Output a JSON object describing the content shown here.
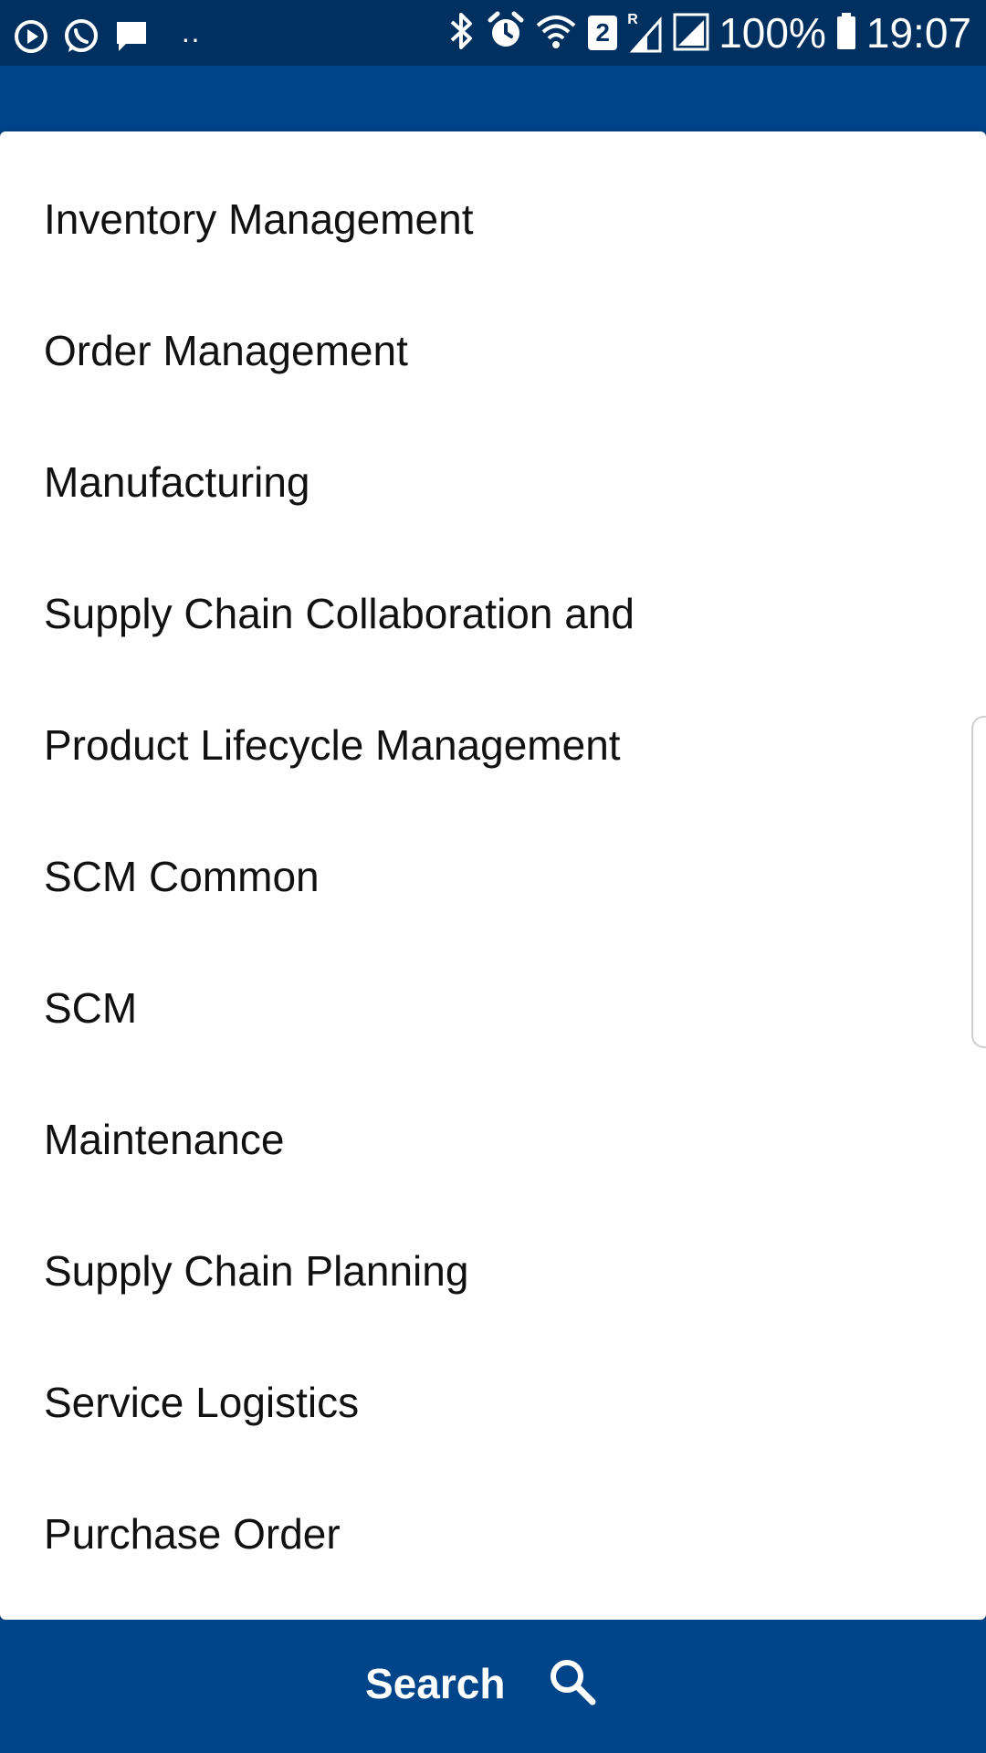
{
  "status_bar": {
    "battery_percent": "100%",
    "time": "19:07",
    "sim_badge": "2",
    "roaming_badge": "R",
    "overflow_dots": "··",
    "icons": [
      "media-play-icon",
      "whatsapp-icon",
      "message-icon",
      "bluetooth-icon",
      "alarm-icon",
      "wifi-icon",
      "sim-2-icon",
      "signal-icon",
      "signal-icon",
      "battery-icon"
    ]
  },
  "dropdown": {
    "items": [
      {
        "label": "Inventory Management"
      },
      {
        "label": "Order Management"
      },
      {
        "label": "Manufacturing"
      },
      {
        "label": "Supply Chain Collaboration and"
      },
      {
        "label": "Product Lifecycle Management"
      },
      {
        "label": "SCM Common"
      },
      {
        "label": "SCM"
      },
      {
        "label": "Maintenance"
      },
      {
        "label": "Supply Chain Planning"
      },
      {
        "label": "Service Logistics"
      },
      {
        "label": "Purchase Order"
      }
    ]
  },
  "bottom": {
    "search_label": "Search"
  },
  "colors": {
    "status_bar": "#00305f",
    "primary": "#00448a",
    "surface": "#ffffff",
    "text": "#111111"
  }
}
